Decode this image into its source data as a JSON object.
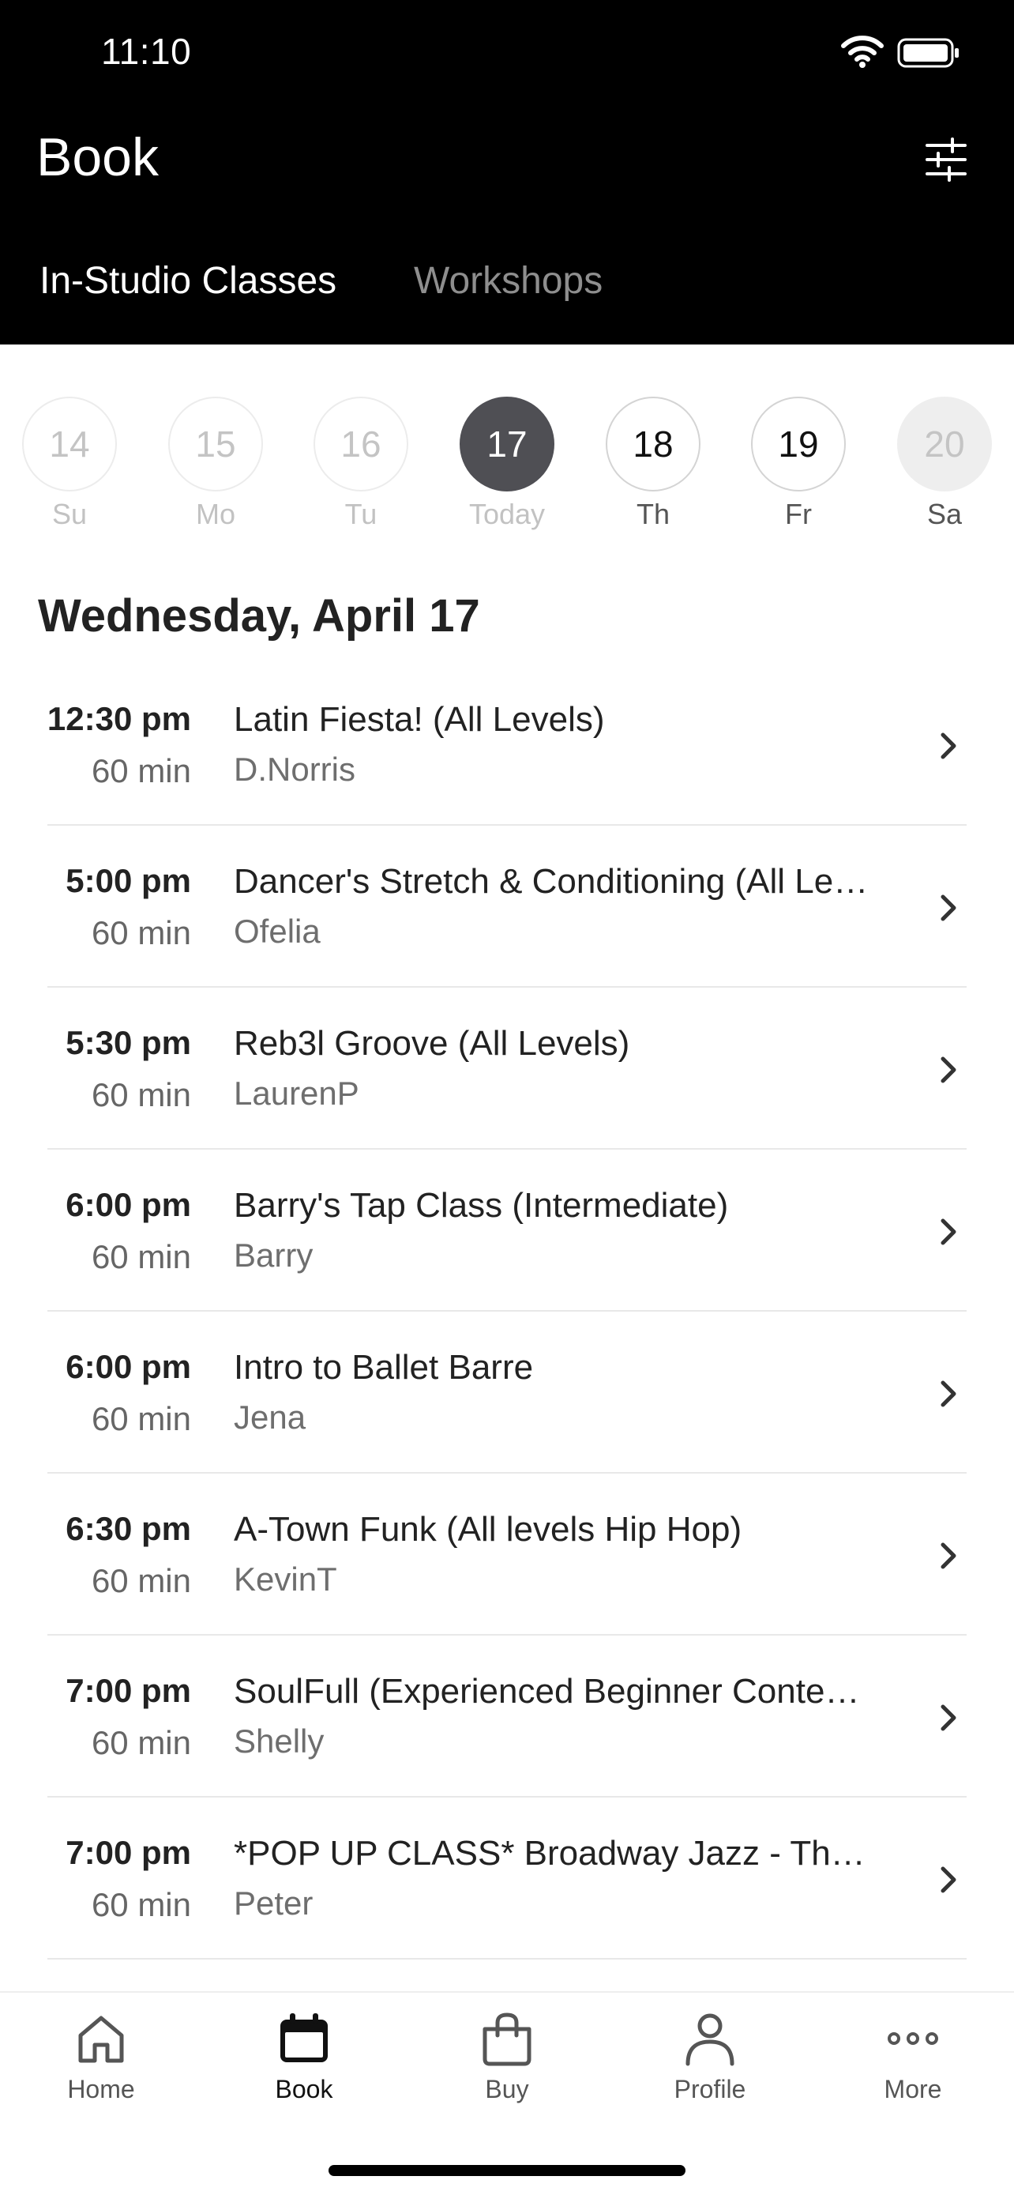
{
  "status_bar": {
    "time": "11:10"
  },
  "header": {
    "title": "Book"
  },
  "tabs": [
    {
      "label": "In-Studio Classes",
      "active": true
    },
    {
      "label": "Workshops",
      "active": false
    }
  ],
  "dates": [
    {
      "day": "14",
      "label": "Su",
      "state": "past"
    },
    {
      "day": "15",
      "label": "Mo",
      "state": "past"
    },
    {
      "day": "16",
      "label": "Tu",
      "state": "past"
    },
    {
      "day": "17",
      "label": "Today",
      "state": "today"
    },
    {
      "day": "18",
      "label": "Th",
      "state": "future"
    },
    {
      "day": "19",
      "label": "Fr",
      "state": "future"
    },
    {
      "day": "20",
      "label": "Sa",
      "state": "disabled"
    }
  ],
  "day_heading": "Wednesday, April 17",
  "classes": [
    {
      "time": "12:30 pm",
      "duration": "60 min",
      "name": "Latin Fiesta! (All Levels)",
      "instructor": "D.Norris"
    },
    {
      "time": "5:00 pm",
      "duration": "60 min",
      "name": "Dancer's Stretch & Conditioning (All Levels)",
      "instructor": "Ofelia"
    },
    {
      "time": "5:30 pm",
      "duration": "60 min",
      "name": "Reb3l Groove (All Levels)",
      "instructor": "LaurenP"
    },
    {
      "time": "6:00 pm",
      "duration": "60 min",
      "name": "Barry's Tap Class (Intermediate)",
      "instructor": "Barry"
    },
    {
      "time": "6:00 pm",
      "duration": "60 min",
      "name": "Intro to Ballet Barre",
      "instructor": "Jena"
    },
    {
      "time": "6:30 pm",
      "duration": "60 min",
      "name": "A-Town Funk (All levels Hip Hop)",
      "instructor": "KevinT"
    },
    {
      "time": "7:00 pm",
      "duration": "60 min",
      "name": "SoulFull (Experienced Beginner Contemporary)",
      "instructor": "Shelly"
    },
    {
      "time": "7:00 pm",
      "duration": "60 min",
      "name": "*POP UP CLASS* Broadway Jazz - Theatre",
      "instructor": "Peter"
    }
  ],
  "tabbar": [
    {
      "label": "Home",
      "icon": "home-icon",
      "active": false
    },
    {
      "label": "Book",
      "icon": "calendar-icon",
      "active": true
    },
    {
      "label": "Buy",
      "icon": "shopping-bag-icon",
      "active": false
    },
    {
      "label": "Profile",
      "icon": "person-icon",
      "active": false
    },
    {
      "label": "More",
      "icon": "ellipsis-icon",
      "active": false
    }
  ],
  "colors": {
    "header_bg": "#000000",
    "today_circle": "#4f4f54",
    "inactive_tab": "#8e8e8e"
  }
}
